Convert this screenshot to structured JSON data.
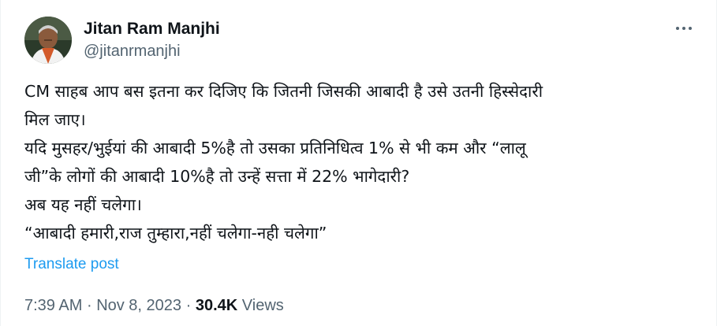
{
  "author": {
    "display_name": "Jitan Ram Manjhi",
    "handle": "@jitanrmanjhi"
  },
  "menu": {
    "icon": "more-horizontal-icon"
  },
  "post": {
    "lines": [
      "CM साहब आप बस इतना कर दिजिए कि जितनी जिसकी आबादी है उसे उतनी हिस्सेदारी",
      "मिल जाए।",
      "यदि मुसहर/भुईयां की आबादी 5%है तो उसका प्रतिनिधित्व 1% से भी कम और “लालू",
      "जी”के लोगों की आबादी 10%है तो उन्हें सत्ता में 22% भागेदारी?",
      "अब यह नहीं चलेगा।",
      "“आबादी हमारी,राज तुम्हारा,नहीं चलेगा-नही चलेगा”"
    ],
    "translate_label": "Translate post"
  },
  "meta": {
    "time": "7:39 AM",
    "separator": "·",
    "date": "Nov 8, 2023",
    "views_count": "30.4K",
    "views_label": "Views"
  },
  "colors": {
    "text_primary": "#0f1419",
    "text_secondary": "#536471",
    "link": "#1d9bf0"
  }
}
